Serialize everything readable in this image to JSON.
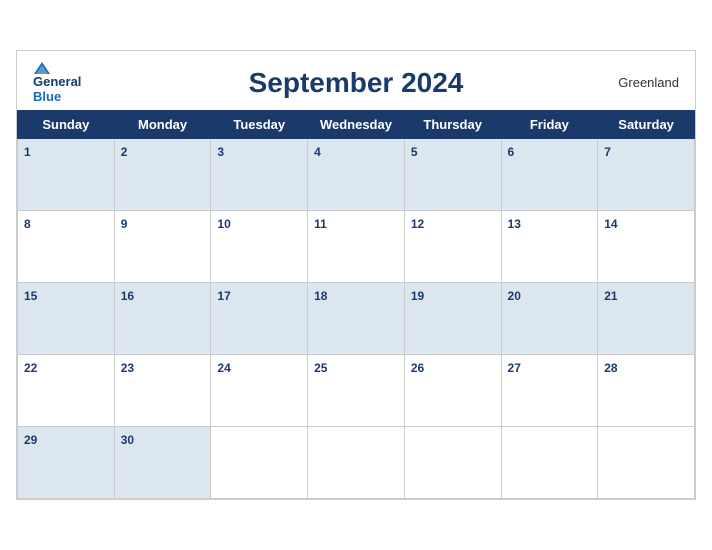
{
  "header": {
    "logo_general": "General",
    "logo_blue": "Blue",
    "month_title": "September 2024",
    "region": "Greenland"
  },
  "weekdays": [
    "Sunday",
    "Monday",
    "Tuesday",
    "Wednesday",
    "Thursday",
    "Friday",
    "Saturday"
  ],
  "weeks": [
    [
      {
        "day": "1",
        "empty": false
      },
      {
        "day": "2",
        "empty": false
      },
      {
        "day": "3",
        "empty": false
      },
      {
        "day": "4",
        "empty": false
      },
      {
        "day": "5",
        "empty": false
      },
      {
        "day": "6",
        "empty": false
      },
      {
        "day": "7",
        "empty": false
      }
    ],
    [
      {
        "day": "8",
        "empty": false
      },
      {
        "day": "9",
        "empty": false
      },
      {
        "day": "10",
        "empty": false
      },
      {
        "day": "11",
        "empty": false
      },
      {
        "day": "12",
        "empty": false
      },
      {
        "day": "13",
        "empty": false
      },
      {
        "day": "14",
        "empty": false
      }
    ],
    [
      {
        "day": "15",
        "empty": false
      },
      {
        "day": "16",
        "empty": false
      },
      {
        "day": "17",
        "empty": false
      },
      {
        "day": "18",
        "empty": false
      },
      {
        "day": "19",
        "empty": false
      },
      {
        "day": "20",
        "empty": false
      },
      {
        "day": "21",
        "empty": false
      }
    ],
    [
      {
        "day": "22",
        "empty": false
      },
      {
        "day": "23",
        "empty": false
      },
      {
        "day": "24",
        "empty": false
      },
      {
        "day": "25",
        "empty": false
      },
      {
        "day": "26",
        "empty": false
      },
      {
        "day": "27",
        "empty": false
      },
      {
        "day": "28",
        "empty": false
      }
    ],
    [
      {
        "day": "29",
        "empty": false
      },
      {
        "day": "30",
        "empty": false
      },
      {
        "day": "",
        "empty": true
      },
      {
        "day": "",
        "empty": true
      },
      {
        "day": "",
        "empty": true
      },
      {
        "day": "",
        "empty": true
      },
      {
        "day": "",
        "empty": true
      }
    ]
  ]
}
